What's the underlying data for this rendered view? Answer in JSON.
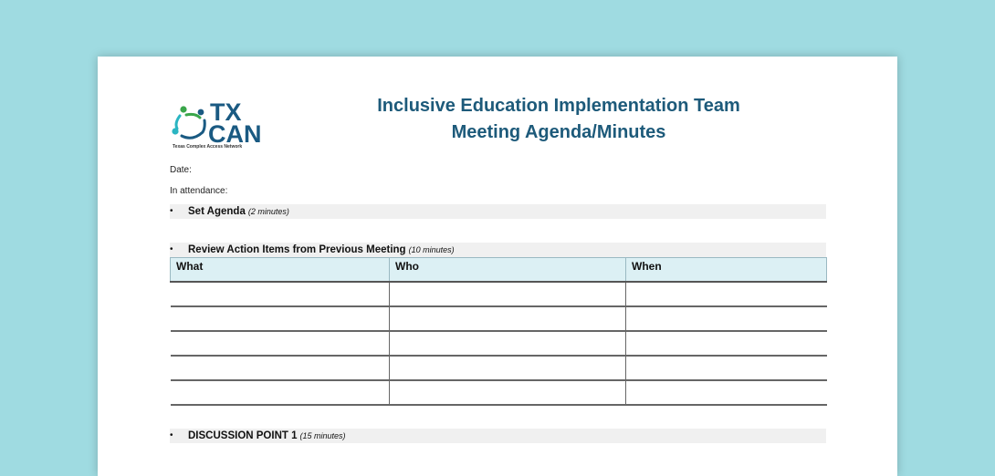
{
  "logo": {
    "line1": "TX",
    "line2": "CAN",
    "subtitle": "Texas Complex Access Network"
  },
  "header": {
    "title_line1": "Inclusive Education Implementation Team",
    "title_line2": "Meeting Agenda/Minutes"
  },
  "meta": {
    "date_label": "Date:",
    "attendance_label": "In attendance:"
  },
  "agenda": {
    "item1": {
      "bullet": "•",
      "label": "Set Agenda",
      "duration": "(2 minutes)"
    },
    "item2": {
      "bullet": "•",
      "label": "Review Action Items from Previous Meeting",
      "duration": "(10 minutes)"
    },
    "item3": {
      "bullet": "•",
      "label": "DISCUSSION POINT 1",
      "duration": "(15 minutes)"
    }
  },
  "action_table": {
    "headers": [
      "What",
      "Who",
      "When"
    ],
    "rows": [
      [
        "",
        "",
        ""
      ],
      [
        "",
        "",
        ""
      ],
      [
        "",
        "",
        ""
      ],
      [
        "",
        "",
        ""
      ],
      [
        "",
        "",
        ""
      ]
    ]
  },
  "colors": {
    "background": "#9fdbe1",
    "title": "#1d5a7a",
    "logo_blue": "#1a5a82",
    "logo_green": "#3aa64a",
    "logo_teal": "#2bb5c2",
    "table_header": "#dcf0f4",
    "section_bar": "#f0f0f0"
  }
}
